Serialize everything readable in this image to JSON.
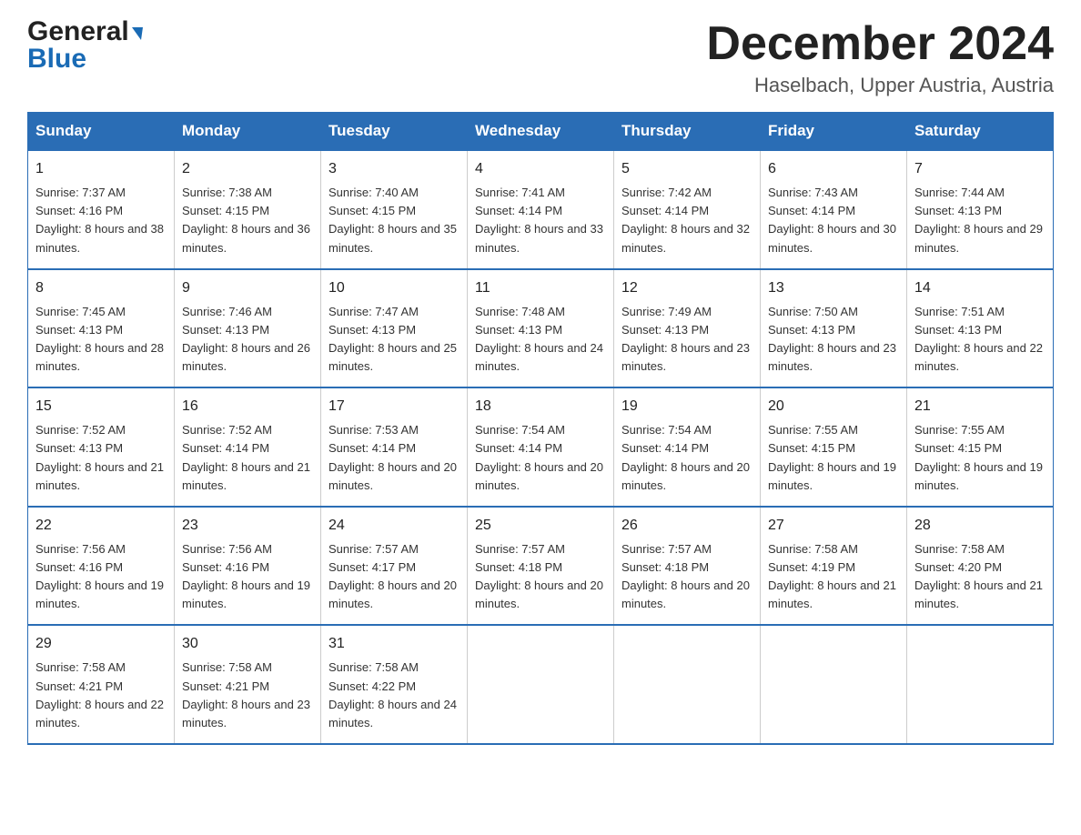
{
  "header": {
    "logo_general": "General",
    "logo_blue": "Blue",
    "month_title": "December 2024",
    "location": "Haselbach, Upper Austria, Austria"
  },
  "days_of_week": [
    "Sunday",
    "Monday",
    "Tuesday",
    "Wednesday",
    "Thursday",
    "Friday",
    "Saturday"
  ],
  "weeks": [
    [
      {
        "day": "1",
        "sunrise": "7:37 AM",
        "sunset": "4:16 PM",
        "daylight": "8 hours and 38 minutes."
      },
      {
        "day": "2",
        "sunrise": "7:38 AM",
        "sunset": "4:15 PM",
        "daylight": "8 hours and 36 minutes."
      },
      {
        "day": "3",
        "sunrise": "7:40 AM",
        "sunset": "4:15 PM",
        "daylight": "8 hours and 35 minutes."
      },
      {
        "day": "4",
        "sunrise": "7:41 AM",
        "sunset": "4:14 PM",
        "daylight": "8 hours and 33 minutes."
      },
      {
        "day": "5",
        "sunrise": "7:42 AM",
        "sunset": "4:14 PM",
        "daylight": "8 hours and 32 minutes."
      },
      {
        "day": "6",
        "sunrise": "7:43 AM",
        "sunset": "4:14 PM",
        "daylight": "8 hours and 30 minutes."
      },
      {
        "day": "7",
        "sunrise": "7:44 AM",
        "sunset": "4:13 PM",
        "daylight": "8 hours and 29 minutes."
      }
    ],
    [
      {
        "day": "8",
        "sunrise": "7:45 AM",
        "sunset": "4:13 PM",
        "daylight": "8 hours and 28 minutes."
      },
      {
        "day": "9",
        "sunrise": "7:46 AM",
        "sunset": "4:13 PM",
        "daylight": "8 hours and 26 minutes."
      },
      {
        "day": "10",
        "sunrise": "7:47 AM",
        "sunset": "4:13 PM",
        "daylight": "8 hours and 25 minutes."
      },
      {
        "day": "11",
        "sunrise": "7:48 AM",
        "sunset": "4:13 PM",
        "daylight": "8 hours and 24 minutes."
      },
      {
        "day": "12",
        "sunrise": "7:49 AM",
        "sunset": "4:13 PM",
        "daylight": "8 hours and 23 minutes."
      },
      {
        "day": "13",
        "sunrise": "7:50 AM",
        "sunset": "4:13 PM",
        "daylight": "8 hours and 23 minutes."
      },
      {
        "day": "14",
        "sunrise": "7:51 AM",
        "sunset": "4:13 PM",
        "daylight": "8 hours and 22 minutes."
      }
    ],
    [
      {
        "day": "15",
        "sunrise": "7:52 AM",
        "sunset": "4:13 PM",
        "daylight": "8 hours and 21 minutes."
      },
      {
        "day": "16",
        "sunrise": "7:52 AM",
        "sunset": "4:14 PM",
        "daylight": "8 hours and 21 minutes."
      },
      {
        "day": "17",
        "sunrise": "7:53 AM",
        "sunset": "4:14 PM",
        "daylight": "8 hours and 20 minutes."
      },
      {
        "day": "18",
        "sunrise": "7:54 AM",
        "sunset": "4:14 PM",
        "daylight": "8 hours and 20 minutes."
      },
      {
        "day": "19",
        "sunrise": "7:54 AM",
        "sunset": "4:14 PM",
        "daylight": "8 hours and 20 minutes."
      },
      {
        "day": "20",
        "sunrise": "7:55 AM",
        "sunset": "4:15 PM",
        "daylight": "8 hours and 19 minutes."
      },
      {
        "day": "21",
        "sunrise": "7:55 AM",
        "sunset": "4:15 PM",
        "daylight": "8 hours and 19 minutes."
      }
    ],
    [
      {
        "day": "22",
        "sunrise": "7:56 AM",
        "sunset": "4:16 PM",
        "daylight": "8 hours and 19 minutes."
      },
      {
        "day": "23",
        "sunrise": "7:56 AM",
        "sunset": "4:16 PM",
        "daylight": "8 hours and 19 minutes."
      },
      {
        "day": "24",
        "sunrise": "7:57 AM",
        "sunset": "4:17 PM",
        "daylight": "8 hours and 20 minutes."
      },
      {
        "day": "25",
        "sunrise": "7:57 AM",
        "sunset": "4:18 PM",
        "daylight": "8 hours and 20 minutes."
      },
      {
        "day": "26",
        "sunrise": "7:57 AM",
        "sunset": "4:18 PM",
        "daylight": "8 hours and 20 minutes."
      },
      {
        "day": "27",
        "sunrise": "7:58 AM",
        "sunset": "4:19 PM",
        "daylight": "8 hours and 21 minutes."
      },
      {
        "day": "28",
        "sunrise": "7:58 AM",
        "sunset": "4:20 PM",
        "daylight": "8 hours and 21 minutes."
      }
    ],
    [
      {
        "day": "29",
        "sunrise": "7:58 AM",
        "sunset": "4:21 PM",
        "daylight": "8 hours and 22 minutes."
      },
      {
        "day": "30",
        "sunrise": "7:58 AM",
        "sunset": "4:21 PM",
        "daylight": "8 hours and 23 minutes."
      },
      {
        "day": "31",
        "sunrise": "7:58 AM",
        "sunset": "4:22 PM",
        "daylight": "8 hours and 24 minutes."
      },
      null,
      null,
      null,
      null
    ]
  ],
  "labels": {
    "sunrise_prefix": "Sunrise: ",
    "sunset_prefix": "Sunset: ",
    "daylight_prefix": "Daylight: "
  }
}
